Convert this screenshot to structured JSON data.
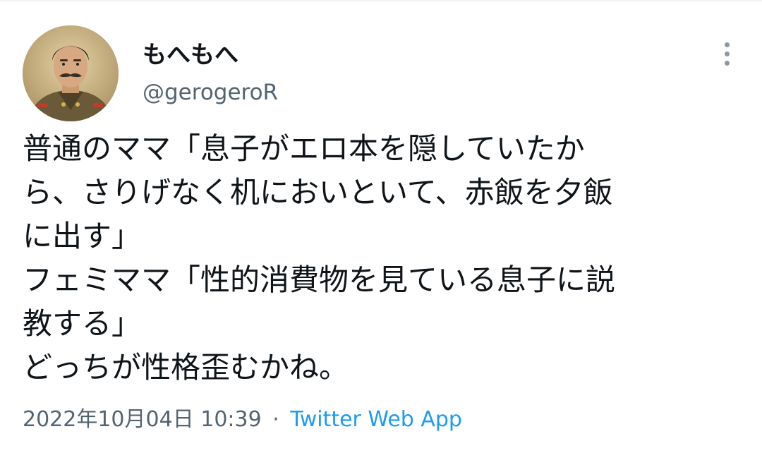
{
  "tweet": {
    "author": {
      "display_name": "もへもへ",
      "handle": "@gerogeroR",
      "avatar_icon": "portrait-avatar"
    },
    "text_lines": [
      "普通のママ「息子がエロ本を隠していたか",
      "ら、さりげなく机においといて、赤飯を夕飯",
      "に出す」",
      "フェミママ「性的消費物を見ている息子に説",
      "教する」",
      "どっちが性格歪むかね。"
    ],
    "timestamp": "2022年10月04日 10:39",
    "separator": "·",
    "source": "Twitter Web App",
    "more_icon": "more-vertical-icon"
  },
  "colors": {
    "text": "#0f1419",
    "secondary": "#536471",
    "link": "#1d9bf0",
    "icon": "#8b98a5"
  }
}
